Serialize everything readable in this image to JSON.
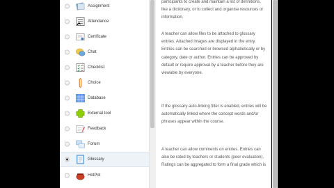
{
  "activities": [
    {
      "label": "Assignment",
      "icon": "assignment-icon",
      "selected": false
    },
    {
      "label": "Attendance",
      "icon": "attendance-icon",
      "selected": false
    },
    {
      "label": "Certificate",
      "icon": "certificate-icon",
      "selected": false
    },
    {
      "label": "Chat",
      "icon": "chat-icon",
      "selected": false
    },
    {
      "label": "Checklist",
      "icon": "checklist-icon",
      "selected": false
    },
    {
      "label": "Choice",
      "icon": "choice-icon",
      "selected": false
    },
    {
      "label": "Database",
      "icon": "database-icon",
      "selected": false
    },
    {
      "label": "External tool",
      "icon": "external-tool-icon",
      "selected": false
    },
    {
      "label": "Feedback",
      "icon": "feedback-icon",
      "selected": false
    },
    {
      "label": "Forum",
      "icon": "forum-icon",
      "selected": false
    },
    {
      "label": "Glossary",
      "icon": "glossary-icon",
      "selected": true
    },
    {
      "label": "HotPot",
      "icon": "hotpot-icon",
      "selected": false
    }
  ],
  "description": {
    "paragraphs": [
      "participants to create and maintain a list of definitions, like a dictionary, or to collect and organise resources or information.",
      "A teacher can allow files to be attached to glossary entries. Attached images are displayed in the entry. Entries can be searched or browsed alphabetically or by category, date or author. Entries can be approved by default or require approval by a teacher before they are viewable by everyone.",
      "If the glossary auto-linking filter is enabled, entries will be automatically linked where the concept words and/or phrases appear within the course.",
      "A teacher can allow comments on entries. Entries can also be rated by teachers or students (peer evaluation). Ratings can be aggregated to form a final grade which is"
    ]
  },
  "colors": {
    "background": "#000000",
    "panel": "#ffffff",
    "selected_row": "#eef3f8",
    "text": "#333333",
    "description_text": "#555555"
  }
}
